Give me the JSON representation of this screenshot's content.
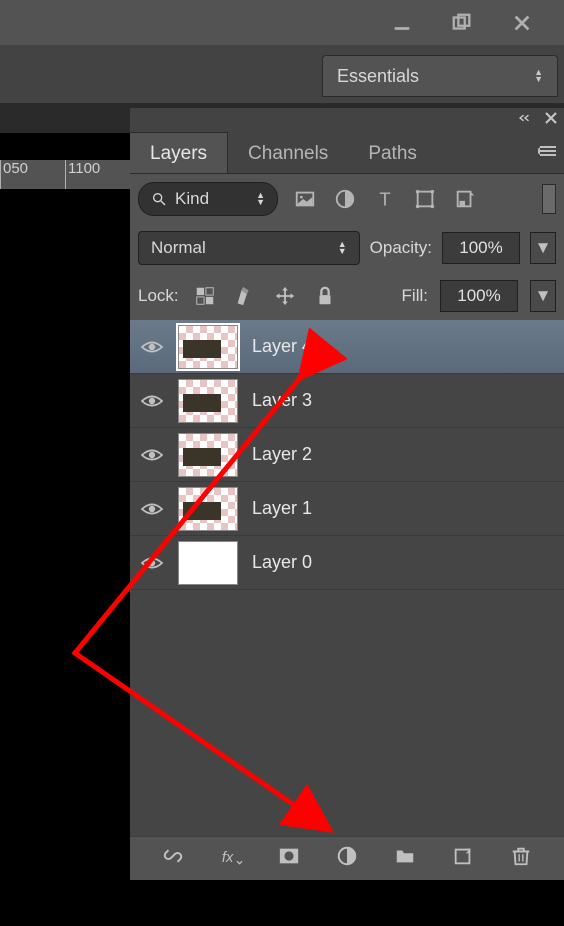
{
  "window": {
    "minimize": "minimize",
    "maximize": "maximize",
    "close": "close"
  },
  "workspace": {
    "selected": "Essentials"
  },
  "ruler": {
    "ticks": [
      "050",
      "1100"
    ]
  },
  "panel": {
    "tabs": [
      {
        "label": "Layers",
        "active": true
      },
      {
        "label": "Channels",
        "active": false
      },
      {
        "label": "Paths",
        "active": false
      }
    ],
    "filter": {
      "label": "Kind"
    },
    "blend_mode": "Normal",
    "opacity": {
      "label": "Opacity:",
      "value": "100%"
    },
    "lock": {
      "label": "Lock:"
    },
    "fill": {
      "label": "Fill:",
      "value": "100%"
    },
    "layers": [
      {
        "name": "Layer 4",
        "visible": true,
        "selected": true,
        "thumb": "img"
      },
      {
        "name": "Layer 3",
        "visible": true,
        "selected": false,
        "thumb": "img"
      },
      {
        "name": "Layer 2",
        "visible": true,
        "selected": false,
        "thumb": "img"
      },
      {
        "name": "Layer 1",
        "visible": true,
        "selected": false,
        "thumb": "img"
      },
      {
        "name": "Layer 0",
        "visible": true,
        "selected": false,
        "thumb": "blank"
      }
    ],
    "foot_icons": [
      "link",
      "fx",
      "mask",
      "adjustment",
      "group",
      "new",
      "trash"
    ]
  }
}
